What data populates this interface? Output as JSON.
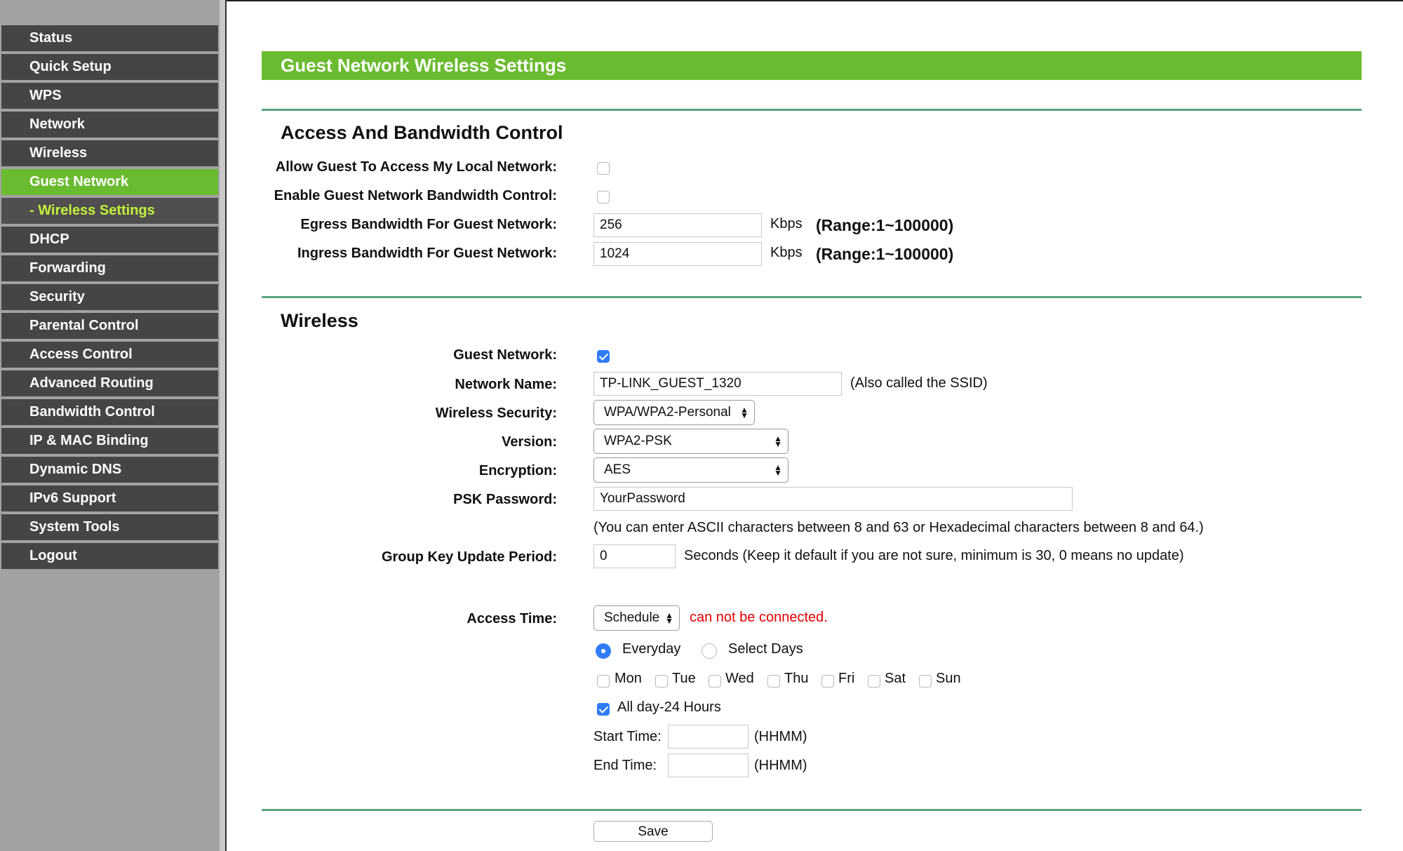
{
  "sidebar": {
    "items": [
      {
        "label": "Status"
      },
      {
        "label": "Quick Setup"
      },
      {
        "label": "WPS"
      },
      {
        "label": "Network"
      },
      {
        "label": "Wireless"
      },
      {
        "label": "Guest Network"
      },
      {
        "label": "- Wireless Settings"
      },
      {
        "label": "DHCP"
      },
      {
        "label": "Forwarding"
      },
      {
        "label": "Security"
      },
      {
        "label": "Parental Control"
      },
      {
        "label": "Access Control"
      },
      {
        "label": "Advanced Routing"
      },
      {
        "label": "Bandwidth Control"
      },
      {
        "label": "IP & MAC Binding"
      },
      {
        "label": "Dynamic DNS"
      },
      {
        "label": "IPv6 Support"
      },
      {
        "label": "System Tools"
      },
      {
        "label": "Logout"
      }
    ],
    "active_index": 5,
    "sub_active_index": 6
  },
  "page": {
    "title": "Guest Network Wireless Settings"
  },
  "access": {
    "title": "Access And Bandwidth Control",
    "allow_local_label": "Allow Guest To Access My Local Network:",
    "allow_local_checked": false,
    "bandwidth_control_label": "Enable Guest Network Bandwidth Control:",
    "bandwidth_control_checked": false,
    "egress_label": "Egress Bandwidth For Guest Network:",
    "egress_value": "256",
    "ingress_label": "Ingress Bandwidth For Guest Network:",
    "ingress_value": "1024",
    "unit": "Kbps",
    "range": "(Range:1~100000)"
  },
  "wireless": {
    "title": "Wireless",
    "guest_network_label": "Guest Network:",
    "guest_network_checked": true,
    "network_name_label": "Network Name:",
    "network_name_value": "TP-LINK_GUEST_1320",
    "ssid_note": "(Also called the SSID)",
    "security_label": "Wireless Security:",
    "security_value": "WPA/WPA2-Personal",
    "version_label": "Version:",
    "version_value": "WPA2-PSK",
    "encryption_label": "Encryption:",
    "encryption_value": "AES",
    "psk_label": "PSK Password:",
    "psk_value": "YourPassword",
    "psk_note": "(You can enter ASCII characters between 8 and 63 or Hexadecimal characters between 8 and 64.)",
    "group_key_label": "Group Key Update Period:",
    "group_key_value": "0",
    "group_key_note": "Seconds (Keep it default if you are not sure, minimum is 30, 0 means no update)"
  },
  "schedule": {
    "access_time_label": "Access Time:",
    "access_time_value": "Schedule",
    "warning": "can not be connected.",
    "warning_color": "#e00000",
    "everyday_label": "Everyday",
    "select_days_label": "Select Days",
    "everyday_selected": true,
    "days": [
      "Mon",
      "Tue",
      "Wed",
      "Thu",
      "Fri",
      "Sat",
      "Sun"
    ],
    "all_day_label": "All day-24 Hours",
    "all_day_checked": true,
    "start_label": "Start Time:",
    "start_value": "",
    "end_label": "End Time:",
    "end_value": "",
    "hhmm": "(HHMM)"
  },
  "actions": {
    "save_label": "Save"
  },
  "colors": {
    "accent_green": "#6abb2f",
    "sidebar_bg": "#454545",
    "sub_item_text": "#c3f03a",
    "checkbox_blue": "#2f7cf6"
  }
}
